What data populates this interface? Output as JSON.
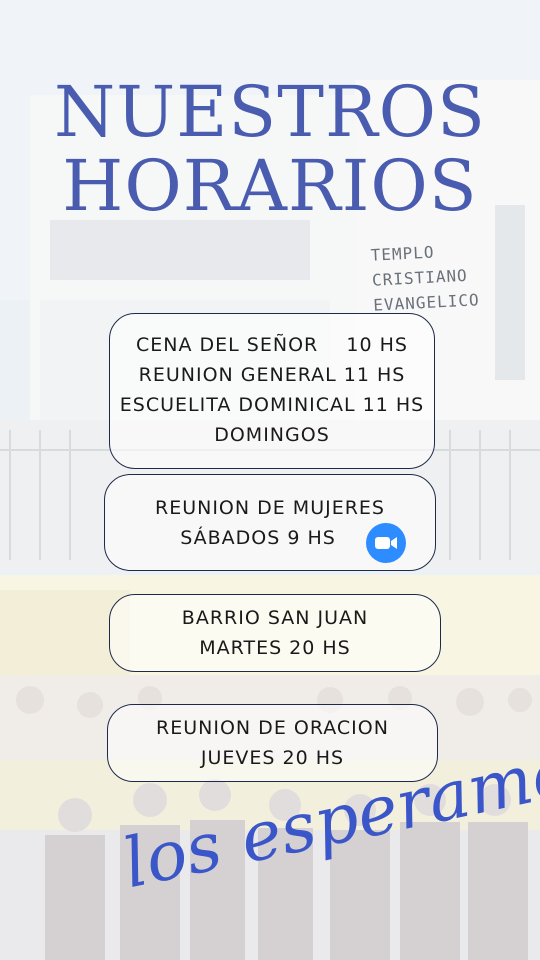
{
  "title": {
    "line1": "NUESTROS",
    "line2": "HORARIOS"
  },
  "building_sign": [
    "TEMPLO",
    "CRISTIANO",
    "EVANGELICO"
  ],
  "cards": {
    "domingos": {
      "line1": "CENA DEL SEÑOR    10 HS",
      "line2": "REUNION GENERAL 11 HS",
      "line3": "ESCUELITA DOMINICAL 11 HS",
      "line4": "DOMINGOS"
    },
    "mujeres": {
      "line1": "REUNION DE MUJERES",
      "line2": "SÁBADOS 9 HS",
      "icon": "zoom-video-icon"
    },
    "barrio": {
      "line1": "BARRIO SAN JUAN",
      "line2": "MARTES 20 HS"
    },
    "oracion": {
      "line1": "REUNION DE ORACION",
      "line2": "JUEVES 20 HS"
    }
  },
  "closing": "los esperamos",
  "colors": {
    "title": "#4a5cb0",
    "script": "#3a56c8",
    "zoom": "#2d8cff",
    "border": "#1e2a4a"
  }
}
